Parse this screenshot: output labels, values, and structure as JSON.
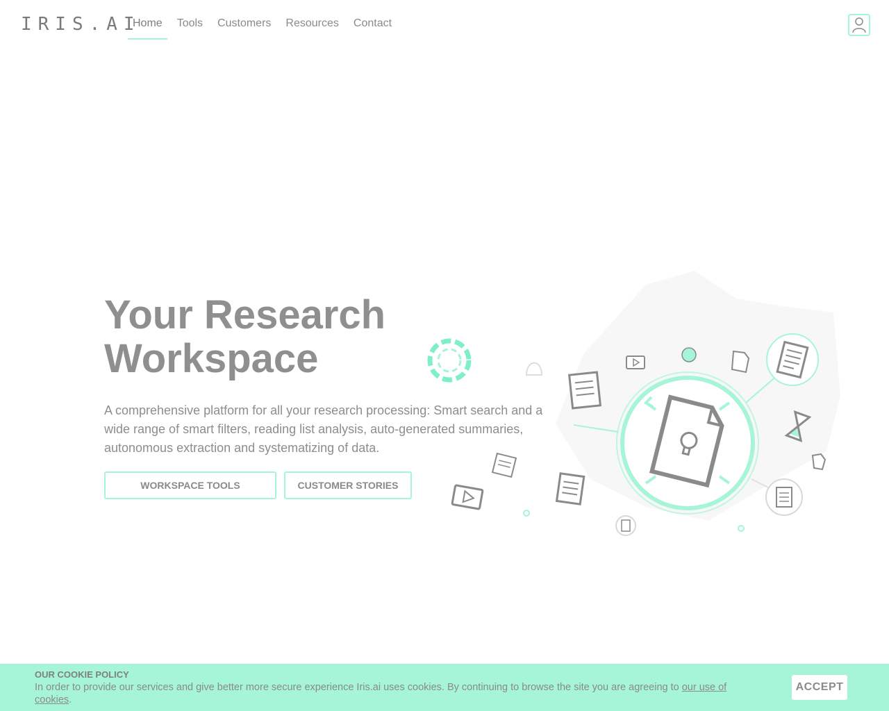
{
  "header": {
    "logo": "IRIS.AI",
    "nav": [
      {
        "label": "Home",
        "active": true
      },
      {
        "label": "Tools"
      },
      {
        "label": "Customers"
      },
      {
        "label": "Resources"
      },
      {
        "label": "Contact"
      }
    ],
    "user_icon": "user-icon"
  },
  "hero": {
    "title_line1": "Your Research",
    "title_line2": "Workspace",
    "description": "A comprehensive platform for all your research processing: Smart search and a wide range of smart filters, reading list analysis, auto-generated summaries, autonomous extraction and systematizing of data.",
    "buttons": {
      "tools": "WORKSPACE TOOLS",
      "stories": "CUSTOMER STORIES"
    }
  },
  "cookie": {
    "title": "OUR COOKIE POLICY",
    "text": "In order to provide our services and give better more secure experience Iris.ai uses cookies. By continuing to browse the site you are agreeing to ",
    "link": "our use of cookies",
    "period": ".",
    "accept": "ACCEPT"
  },
  "colors": {
    "accent": "#a6f5d7",
    "accent_strong": "#7ff0c6",
    "text": "#8a8a8a"
  }
}
